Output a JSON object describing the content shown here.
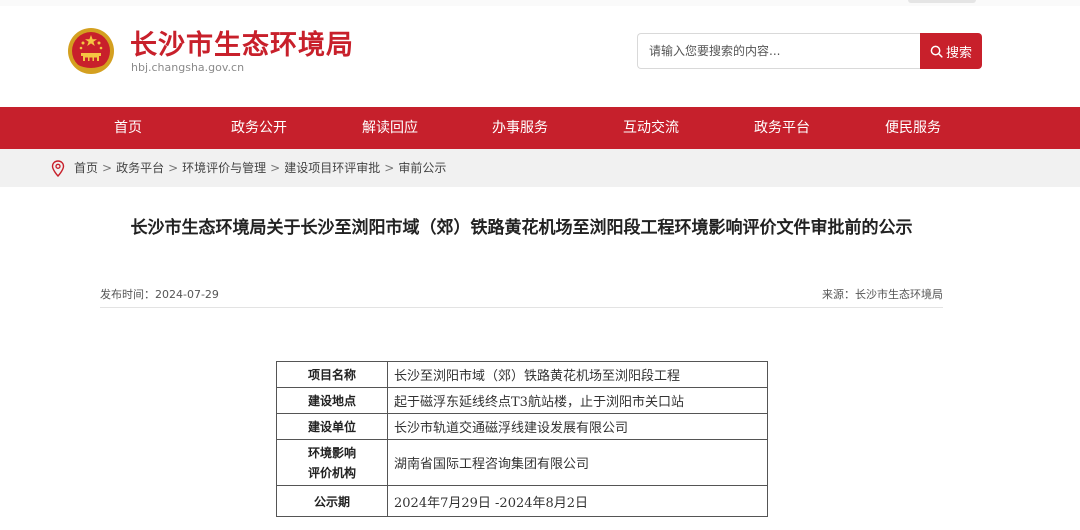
{
  "header": {
    "site_title": "长沙市生态环境局",
    "site_domain": "hbj.changsha.gov.cn",
    "emblem_icon": "national-emblem-icon",
    "brand_color": "#c8202b"
  },
  "search": {
    "placeholder": "请输入您要搜索的内容...",
    "button_label": "搜索"
  },
  "nav": {
    "items": [
      {
        "label": "首页"
      },
      {
        "label": "政务公开"
      },
      {
        "label": "解读回应"
      },
      {
        "label": "办事服务"
      },
      {
        "label": "互动交流"
      },
      {
        "label": "政务平台"
      },
      {
        "label": "便民服务"
      }
    ]
  },
  "breadcrumb": {
    "items": [
      "首页",
      "政务平台",
      "环境评价与管理",
      "建设项目环评审批",
      "审前公示"
    ],
    "separator": ">"
  },
  "article": {
    "title": "长沙市生态环境局关于长沙至浏阳市域（郊）铁路黄花机场至浏阳段工程环境影响评价文件审批前的公示",
    "publish_time": "发布时间：2024-07-29",
    "source": "来源：长沙市生态环境局"
  },
  "table": {
    "rows": [
      {
        "key": "项目名称",
        "value": "长沙至浏阳市域（郊）铁路黄花机场至浏阳段工程"
      },
      {
        "key": "建设地点",
        "value": "起于磁浮东延线终点T3航站楼，止于浏阳市关口站"
      },
      {
        "key": "建设单位",
        "value": "长沙市轨道交通磁浮线建设发展有限公司"
      },
      {
        "key_line1": "环境影响",
        "key_line2": "评价机构",
        "value": "湖南省国际工程咨询集团有限公司"
      },
      {
        "key": "公示期",
        "value": "2024年7月29日 -2024年8月2日"
      }
    ]
  }
}
